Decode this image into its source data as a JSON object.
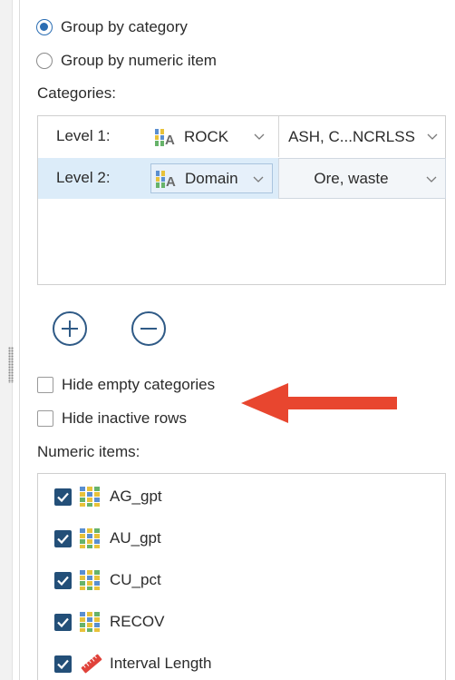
{
  "grouping": {
    "option_category": "Group by category",
    "option_numeric": "Group by numeric item",
    "selected": "category"
  },
  "categories": {
    "label": "Categories:",
    "rows": [
      {
        "level": "Level 1:",
        "item": "ROCK",
        "values": "ASH, C...NCRLSS"
      },
      {
        "level": "Level 2:",
        "item": "Domain",
        "values": "Ore, waste"
      }
    ]
  },
  "buttons": {
    "add": "+",
    "remove": "−"
  },
  "options": {
    "hide_empty": "Hide empty categories",
    "hide_inactive": "Hide inactive rows"
  },
  "numeric": {
    "label": "Numeric items:",
    "items": [
      {
        "name": "AG_gpt",
        "checked": true,
        "icon": "numeric-column-icon"
      },
      {
        "name": "AU_gpt",
        "checked": true,
        "icon": "numeric-column-icon"
      },
      {
        "name": "CU_pct",
        "checked": true,
        "icon": "numeric-column-icon"
      },
      {
        "name": "RECOV",
        "checked": true,
        "icon": "numeric-column-icon"
      },
      {
        "name": "Interval Length",
        "checked": true,
        "icon": "ruler-icon"
      }
    ]
  },
  "colors": {
    "accent": "#2a6db3",
    "checkbox": "#234f78",
    "arrow": "#e8462f",
    "selection": "#dcecf9"
  }
}
